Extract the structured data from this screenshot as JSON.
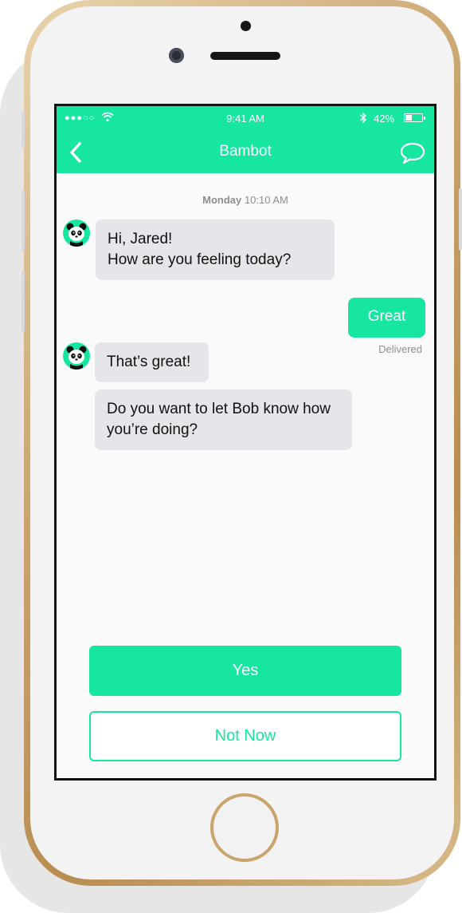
{
  "colors": {
    "accent": "#17e6a1",
    "incoming_bubble": "#e5e5ea",
    "meta_text": "#8e8e93",
    "frame_gold": "#c9a46d"
  },
  "status_bar": {
    "signal_icon": "signal-dots-icon",
    "wifi_icon": "wifi-icon",
    "time": "9:41 AM",
    "bluetooth_icon": "bluetooth-icon",
    "battery_percent": "42%",
    "battery_level": 0.42
  },
  "nav": {
    "back_icon": "chevron-left-icon",
    "title": "Bambot",
    "chat_icon": "speech-bubble-icon"
  },
  "chat": {
    "timestamp_day": "Monday",
    "timestamp_time": "10:10 AM",
    "bot_avatar_icon": "panda-avatar-icon",
    "messages": [
      {
        "from": "bot",
        "lines": [
          "Hi, Jared!",
          "How are you feeling today?"
        ]
      },
      {
        "from": "user",
        "lines": [
          "Great"
        ],
        "status": "Delivered"
      },
      {
        "from": "bot",
        "lines": [
          "That’s great!"
        ]
      },
      {
        "from": "bot",
        "lines": [
          "Do you want to let Bob know how",
          "you’re doing?"
        ]
      }
    ]
  },
  "actions": {
    "yes_label": "Yes",
    "not_now_label": "Not Now"
  }
}
